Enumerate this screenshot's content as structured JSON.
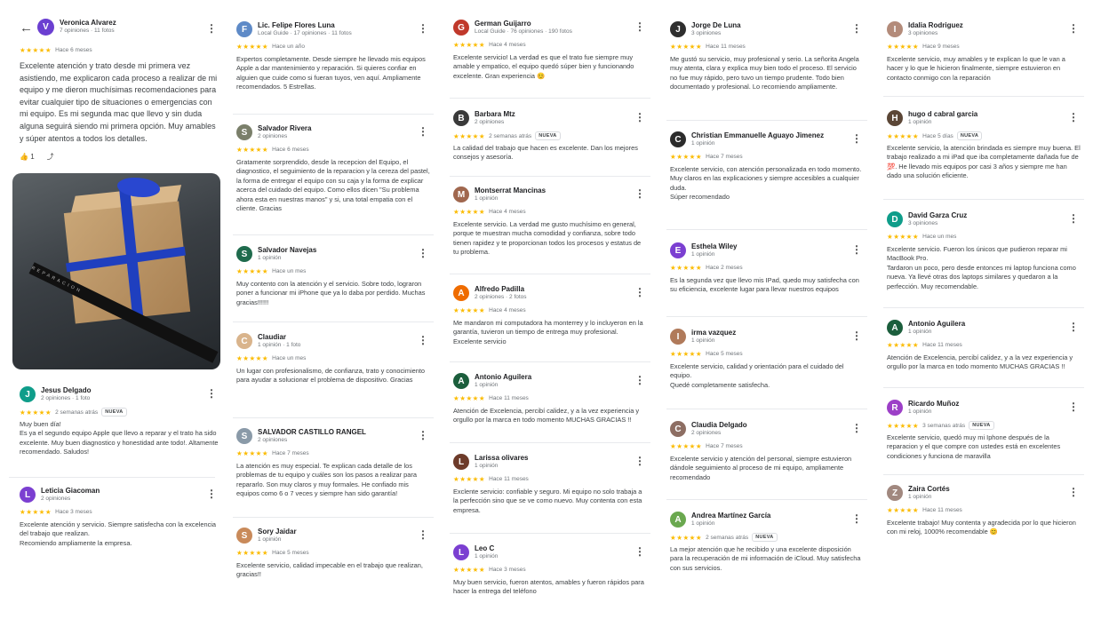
{
  "detail": {
    "author": "Veronica Alvarez",
    "meta": "7 opiniones · 11 fotos",
    "initial": "V",
    "avatar_color": "#6b3fd1",
    "stars": "★★★★★",
    "time": "Hace 6 meses",
    "text": "Excelente atención y trato desde mi primera vez asistiendo, me explicaron cada proceso a realizar de mi equipo y me dieron muchísimas recomendaciones para evitar cualquier tipo de situaciones o emergencias con mi equipo. Es mi segunda mac que llevo y sin duda alguna seguirá siendo mi primera opción. Muy amables y súper atentos a todos los detalles.",
    "likes": "1",
    "photo_text": "REPARACION"
  },
  "column1": [
    {
      "author": "Jesus Delgado",
      "meta": "2 opiniones · 1 foto",
      "initial": "J",
      "color": "#0f9d8a",
      "stars": "★★★★★",
      "time": "2 semanas atrás",
      "badge": "NUEVA",
      "text": "Muy buen día!\nEs ya el segundo equipo Apple que llevo a reparar y el trato ha sido excelente. Muy buen diagnostico y honestidad ante todo!. Altamente recomendado. Saludos!"
    },
    {
      "author": "Leticia Giacoman",
      "meta": "2 opiniones",
      "initial": "L",
      "color": "#7b3fd1",
      "stars": "★★★★★",
      "time": "Hace 3 meses",
      "badge": "",
      "text": "Excelente atención y servicio. Siempre satisfecha con la excelencia del trabajo que realizan.\nRecomiendo ampliamente la empresa."
    }
  ],
  "column2": [
    {
      "author": "Lic. Felipe Flores Luna",
      "meta": "Local Guide · 17 opiniones · 11 fotos",
      "initial": "F",
      "color": "#5e8ac7",
      "stars": "★★★★★",
      "time": "Hace un año",
      "badge": "",
      "text": "Expertos completamente. Desde siempre he llevado mis equipos Apple a dar mantenimiento y reparación. Si quieres confiar en alguien que cuide como si fueran tuyos, ven aquí. Ampliamente recomendados. 5 Estrellas."
    },
    {
      "author": "Salvador Rivera",
      "meta": "2 opiniones",
      "initial": "S",
      "color": "#7a7f6a",
      "stars": "★★★★★",
      "time": "Hace 6 meses",
      "badge": "",
      "text": "Gratamente sorprendido, desde la recepcion del Equipo, el diagnostico, el seguimiento de la reparacion y la cereza del pastel, la forma de entregar el equipo con su caja y la forma de explicar acerca del cuidado del equipo. Como ellos dicen \"Su problema ahora esta en nuestras manos\" y si, una total empatia con el cliente. Gracias"
    },
    {
      "author": "Salvador Navejas",
      "meta": "1 opinión",
      "initial": "S",
      "color": "#1f6b4d",
      "stars": "★★★★★",
      "time": "Hace un mes",
      "badge": "",
      "text": "Muy contento con la atención y el servicio. Sobre todo, lograron poner a funcionar mi iPhone que ya lo daba por perdido. Muchas gracias!!!!!!"
    },
    {
      "author": "Claudiar",
      "meta": "1 opinión · 1 foto",
      "initial": "C",
      "color": "#d9b48c",
      "stars": "★★★★★",
      "time": "Hace un mes",
      "badge": "",
      "text": "Un lugar con profesionalismo, de confianza, trato y conocimiento para ayudar a solucionar el problema de dispositivo. Gracias"
    },
    {
      "author": "SALVADOR CASTILLO RANGEL",
      "meta": "2 opiniones",
      "initial": "S",
      "color": "#8a9aa8",
      "stars": "★★★★★",
      "time": "Hace 7 meses",
      "badge": "",
      "text": "La atención es muy especial. Te explican cada detalle de los problemas de tu equipo y cuáles son los pasos a realizar para repararlo. Son muy claros y muy formales. He confiado mis equipos como 6 o 7 veces y siempre han sido garantía!"
    },
    {
      "author": "Sory Jaidar",
      "meta": "1 opinión",
      "initial": "S",
      "color": "#c98a5a",
      "stars": "★★★★★",
      "time": "Hace 5 meses",
      "badge": "",
      "text": "Excelente servicio, calidad impecable en el trabajo que realizan, gracias!!"
    }
  ],
  "column3": [
    {
      "author": "German Guijarro",
      "meta": "Local Guide · 76 opiniones · 190 fotos",
      "initial": "G",
      "color": "#c0392b",
      "stars": "★★★★★",
      "time": "Hace 4 meses",
      "badge": "",
      "text": "Excelente servicio! La verdad es que el trato fue siempre muy amable y empatico, el equipo quedó súper bien y funcionando excelente. Gran experiencia 😊"
    },
    {
      "author": "Barbara Mtz",
      "meta": "2 opiniones",
      "initial": "B",
      "color": "#3a3a3a",
      "stars": "★★★★★",
      "time": "2 semanas atrás",
      "badge": "NUEVA",
      "text": "La calidad del trabajo que hacen es excelente. Dan los mejores consejos y asesoría."
    },
    {
      "author": "Montserrat Mancinas",
      "meta": "1 opinión",
      "initial": "M",
      "color": "#a0674e",
      "stars": "★★★★★",
      "time": "Hace 4 meses",
      "badge": "",
      "text": "Excelente servicio. La verdad me gusto muchísimo en general, porque te muestran mucha comodidad y confianza, sobre todo tienen rapidez y te proporcionan todos los procesos y estatus de tu problema."
    },
    {
      "author": "Alfredo Padilla",
      "meta": "2 opiniones · 2 fotos",
      "initial": "A",
      "color": "#ef6c00",
      "stars": "★★★★★",
      "time": "Hace 4 meses",
      "badge": "",
      "text": "Me mandaron mi computadora ha monterrey y lo incluyeron en la garantía, tuvieron un tiempo de entrega muy profesional. Excelente servicio"
    },
    {
      "author": "Antonio Aguilera",
      "meta": "1 opinión",
      "initial": "A",
      "color": "#1b5e3c",
      "stars": "★★★★★",
      "time": "Hace 11 meses",
      "badge": "",
      "text": "Atención de Excelencia, percibí calidez, y a la vez experiencia y orgullo por la marca en todo momento MUCHAS GRACIAS !!"
    },
    {
      "author": "Larissa olivares",
      "meta": "1 opinión",
      "initial": "L",
      "color": "#6d3b2a",
      "stars": "★★★★★",
      "time": "Hace 11 meses",
      "badge": "",
      "text": "Exclente servicio: confiable y seguro. Mi equipo no solo trabaja a la perfección sino que se ve como nuevo. Muy contenta con esta empresa."
    },
    {
      "author": "Leo C",
      "meta": "1 opinión",
      "initial": "L",
      "color": "#7b3fd1",
      "stars": "★★★★★",
      "time": "Hace 3 meses",
      "badge": "",
      "text": "Muy buen servicio, fueron atentos, amables y fueron rápidos para hacer la entrega del teléfono"
    }
  ],
  "column4": [
    {
      "author": "Jorge De Luna",
      "meta": "3 opiniones",
      "initial": "J",
      "color": "#2e2e2e",
      "stars": "★★★★★",
      "time": "Hace 11 meses",
      "badge": "",
      "text": "Me gustó su servicio, muy profesional y serio. La señorita Angela muy atenta, clara y explica muy bien todo el proceso. El servicio no fue muy rápido, pero tuvo un tiempo prudente. Todo bien documentado y profesional. Lo recomiendo ampliamente."
    },
    {
      "author": "Christian Emmanuelle Aguayo Jimenez",
      "meta": "1 opinión",
      "initial": "C",
      "color": "#2b2b2b",
      "stars": "★★★★★",
      "time": "Hace 7 meses",
      "badge": "",
      "text": "Excelente servicio, con atención personalizada en todo momento.\nMuy claros en las explicaciones y siempre accesibles a cualquier duda.\nSúper recomendado"
    },
    {
      "author": "Esthela Wiley",
      "meta": "1 opinión",
      "initial": "E",
      "color": "#7b3fd1",
      "stars": "★★★★★",
      "time": "Hace 2 meses",
      "badge": "",
      "text": "Es la segunda vez que llevo mis IPad, quedo muy satisfecha con su eficiencia, excelente lugar para llevar nuestros equipos"
    },
    {
      "author": "irma vazquez",
      "meta": "1 opinión",
      "initial": "I",
      "color": "#b07a5a",
      "stars": "★★★★★",
      "time": "Hace 5 meses",
      "badge": "",
      "text": "Excelente servicio, calidad y orientación para el cuidado del equipo.\nQuedé completamente satisfecha."
    },
    {
      "author": "Claudia Delgado",
      "meta": "2 opiniones",
      "initial": "C",
      "color": "#8d6e63",
      "stars": "★★★★★",
      "time": "Hace 7 meses",
      "badge": "",
      "text": "Excelente servicio y atención del personal, siempre estuvieron dándole seguimiento al proceso de mi equipo, ampliamente recomendado"
    },
    {
      "author": "Andrea Martínez García",
      "meta": "1 opinión",
      "initial": "A",
      "color": "#6aa84f",
      "stars": "★★★★★",
      "time": "2 semanas atrás",
      "badge": "NUEVA",
      "text": "La mejor atención que he recibido y una excelente disposición para la recuperación de mi información de iCloud. Muy satisfecha con sus servicios."
    }
  ],
  "column5": [
    {
      "author": "Idalia Rodriguez",
      "meta": "3 opiniones",
      "initial": "I",
      "color": "#b38b7a",
      "stars": "★★★★★",
      "time": "Hace 9 meses",
      "badge": "",
      "text": "Excelente servicio, muy amables y te explican lo que le van a hacer y lo que le hicieron finalmente, siempre estuvieron en contacto conmigo con la reparación"
    },
    {
      "author": "hugo d cabral garcia",
      "meta": "1 opinión",
      "initial": "H",
      "color": "#5b4636",
      "stars": "★★★★★",
      "time": "Hace 5 días",
      "badge": "NUEVA",
      "text": "Excelente servicio, la atención brindada es siempre muy buena. El trabajo realizado a mi iPad que iba completamente dañada fue de 💯. He llevado mis equipos por casi 3 años y siempre me han dado una solución eficiente."
    },
    {
      "author": "David Garza Cruz",
      "meta": "3 opiniones",
      "initial": "D",
      "color": "#0f9d8a",
      "stars": "★★★★★",
      "time": "Hace un mes",
      "badge": "",
      "text": "Excelente servicio. Fueron los únicos que pudieron reparar mi MacBook Pro.\nTardaron un poco, pero desde entonces mi laptop funciona como nueva. Ya llevé otras dos laptops similares y quedaron a la perfección. Muy recomendable."
    },
    {
      "author": "Antonio Aguilera",
      "meta": "1 opinión",
      "initial": "A",
      "color": "#1b5e3c",
      "stars": "★★★★★",
      "time": "Hace 11 meses",
      "badge": "",
      "text": "Atención de Excelencia, percibí calidez, y a la vez experiencia y orgullo por la marca en todo momento MUCHAS GRACIAS !!"
    },
    {
      "author": "Ricardo Muñoz",
      "meta": "1 opinión",
      "initial": "R",
      "color": "#9c3fc7",
      "stars": "★★★★★",
      "time": "3 semanas atrás",
      "badge": "NUEVA",
      "text": "Excelente servicio, quedó muy mi Iphone después de la reparacion y el que compre con ustedes está en excelentes condiciones y funciona de maravilla"
    },
    {
      "author": "Zaira Cortés",
      "meta": "1 opinión",
      "initial": "Z",
      "color": "#a1887f",
      "stars": "★★★★★",
      "time": "Hace 11 meses",
      "badge": "",
      "text": "Excelente trabajo! Muy contenta y agradecida por lo que hicieron con mi reloj, 1000% recomendable 😊"
    }
  ]
}
